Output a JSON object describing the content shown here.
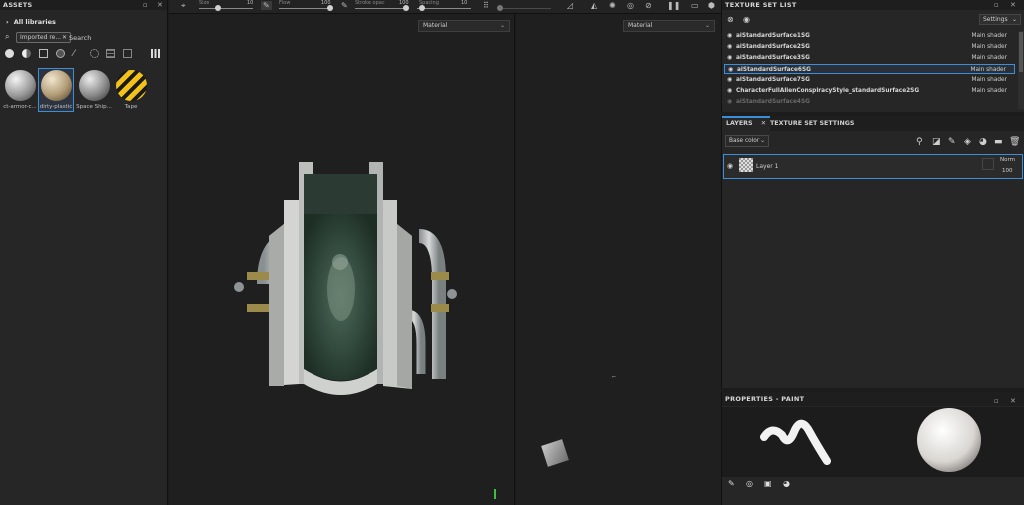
{
  "assets": {
    "title": "ASSETS",
    "library": "All libraries",
    "filter_chip": "Imported re...",
    "search_label": "Search",
    "items": [
      {
        "label": "ct-armor-c...",
        "color": "#b8b8b8"
      },
      {
        "label": "dirty-plastic",
        "color": "#c9b89a"
      },
      {
        "label": "Space Ship...",
        "color": "#9a9a9a"
      },
      {
        "label": "Tape",
        "color": "#d9a520"
      }
    ]
  },
  "toolbar": {
    "size_label": "Size",
    "size_value": "10",
    "flow_label": "Flow",
    "flow_value": "100",
    "stroke_label": "Stroke opac",
    "stroke_value": "100",
    "spacing_label": "Spacing",
    "spacing_value": "10"
  },
  "viewport3d": {
    "material_label": "Material"
  },
  "viewport2d": {
    "material_label": "Material"
  },
  "texture_set_list": {
    "title": "TEXTURE SET LIST",
    "settings_label": "Settings",
    "rows": [
      {
        "name": "aiStandardSurface1SG",
        "shader": "Main shader"
      },
      {
        "name": "aiStandardSurface2SG",
        "shader": "Main shader"
      },
      {
        "name": "aiStandardSurface3SG",
        "shader": "Main shader"
      },
      {
        "name": "aiStandardSurface6SG",
        "shader": "Main shader"
      },
      {
        "name": "aiStandardSurface7SG",
        "shader": "Main shader"
      },
      {
        "name": "CharacterFullAlienConspiracyStyle_standardSurface2SG",
        "shader": "Main shader"
      },
      {
        "name": "aiStandardSurface4SG",
        "shader": ""
      }
    ],
    "selected_index": 3
  },
  "layers": {
    "tab_layers": "LAYERS",
    "tab_tss": "TEXTURE SET SETTINGS",
    "channel": "Base color",
    "layer_name": "Layer 1",
    "blend_mode": "Norm",
    "opacity": "100"
  },
  "properties": {
    "title": "PROPERTIES - PAINT"
  },
  "colors": {
    "accent": "#3a8fd8"
  }
}
